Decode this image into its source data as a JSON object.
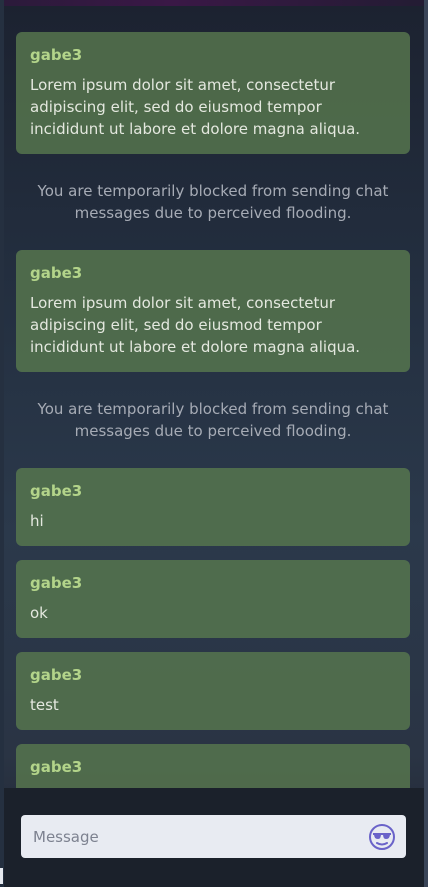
{
  "messages": [
    {
      "kind": "user",
      "user": "gabe3",
      "text": "Lorem ipsum dolor sit amet, consectetur adipiscing elit, sed do eiusmod tempor incididunt ut labore et dolore magna aliqua."
    },
    {
      "kind": "system",
      "text": "You are temporarily blocked from sending chat messages due to perceived flooding."
    },
    {
      "kind": "user",
      "user": "gabe3",
      "text": "Lorem ipsum dolor sit amet, consectetur adipiscing elit, sed do eiusmod tempor incididunt ut labore et dolore magna aliqua."
    },
    {
      "kind": "system",
      "text": "You are temporarily blocked from sending chat messages due to perceived flooding."
    },
    {
      "kind": "user",
      "user": "gabe3",
      "text": "hi"
    },
    {
      "kind": "user",
      "user": "gabe3",
      "text": "ok"
    },
    {
      "kind": "user",
      "user": "gabe3",
      "text": "test"
    },
    {
      "kind": "user",
      "user": "gabe3",
      "text": ""
    }
  ],
  "composer": {
    "placeholder": "Message",
    "value": "",
    "emoji_icon": "sunglasses-emoji-icon"
  },
  "colors": {
    "message_bg": "#58784e",
    "username": "#b3d48a",
    "system_text": "#a6abb5",
    "input_bg": "#e8ebf2",
    "emoji_accent": "#6a63c9"
  }
}
